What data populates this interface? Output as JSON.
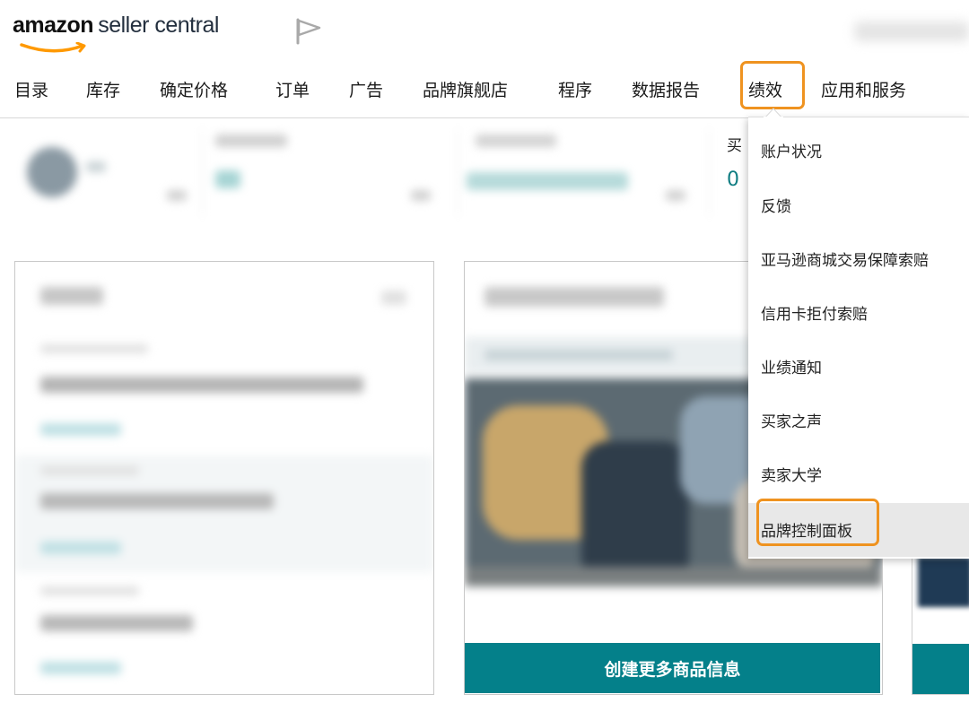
{
  "header": {
    "logo_primary": "amazon",
    "logo_secondary": "seller central",
    "flag_icon": "flag-icon"
  },
  "nav": {
    "items": [
      {
        "label": "目录"
      },
      {
        "label": "库存"
      },
      {
        "label": "确定价格"
      },
      {
        "label": "订单"
      },
      {
        "label": "广告"
      },
      {
        "label": "品牌旗舰店"
      },
      {
        "label": "程序"
      },
      {
        "label": "数据报告"
      },
      {
        "label": "绩效"
      },
      {
        "label": "应用和服务"
      }
    ],
    "active_index": 8
  },
  "summary": {
    "buyer_messages_title": "买",
    "buyer_messages_value": "0"
  },
  "performance_menu": {
    "items": [
      {
        "label": "账户状况"
      },
      {
        "label": "反馈"
      },
      {
        "label": "亚马逊商城交易保障索赔"
      },
      {
        "label": "信用卡拒付索赔"
      },
      {
        "label": "业绩通知"
      },
      {
        "label": "买家之声"
      },
      {
        "label": "卖家大学"
      },
      {
        "label": "品牌控制面板"
      }
    ],
    "highlighted_index": 7
  },
  "cards": {
    "cta_label": "创建更多商品信息"
  },
  "colors": {
    "accent_highlight": "#ef9320",
    "teal": "#04808a",
    "value_teal": "#0f7d82"
  }
}
